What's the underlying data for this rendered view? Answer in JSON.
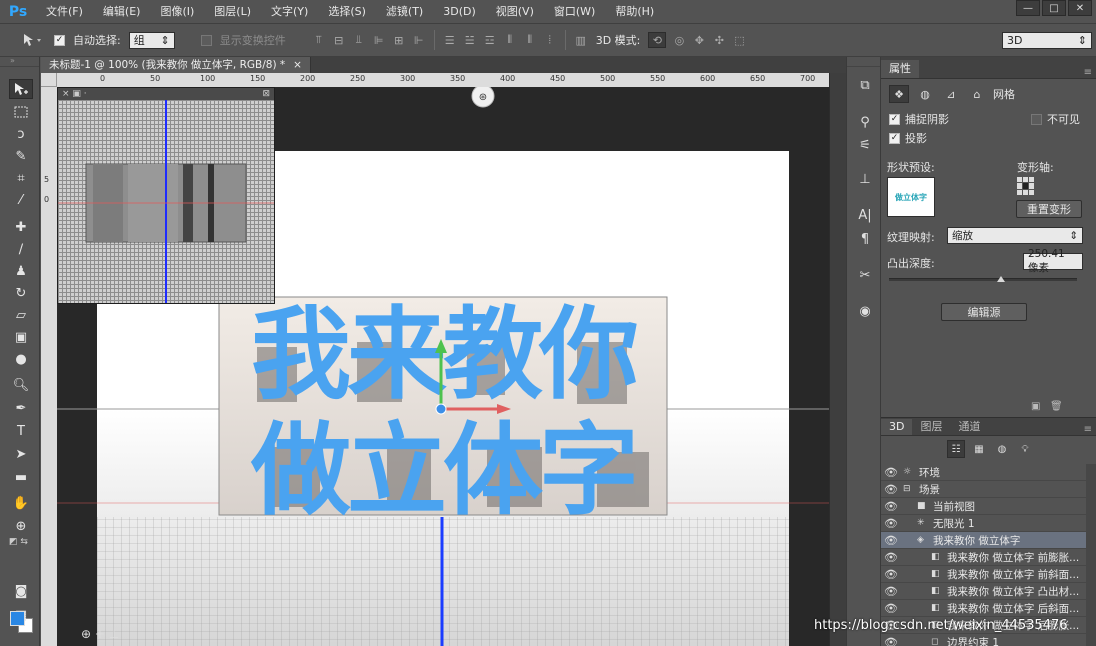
{
  "app": {
    "logo": "Ps"
  },
  "menu": [
    "文件(F)",
    "编辑(E)",
    "图像(I)",
    "图层(L)",
    "文字(Y)",
    "选择(S)",
    "滤镜(T)",
    "3D(D)",
    "视图(V)",
    "窗口(W)",
    "帮助(H)"
  ],
  "window_controls": {
    "minimize": "—",
    "maximize": "□",
    "close": "✕"
  },
  "options": {
    "auto_select_label": "自动选择:",
    "auto_select_checked": true,
    "auto_select_value": "组",
    "show_transform_label": "显示变换控件",
    "show_transform_checked": false,
    "mode_3d_label": "3D 模式:",
    "workspace_value": "3D"
  },
  "document": {
    "tab_title": "未标题-1 @ 100% (我来教你 做立体字, RGB/8) *",
    "tab_close": "×",
    "ruler_h_marks": [
      "0",
      "50",
      "100",
      "150",
      "200",
      "250",
      "300",
      "350",
      "400",
      "450",
      "500",
      "550",
      "600",
      "650",
      "700",
      "750"
    ],
    "text_line1": "我来教你",
    "text_line2": "做立体字"
  },
  "properties": {
    "tab": "属性",
    "subtab_mesh": "网格",
    "catch_shadows": "捕捉阴影",
    "catch_shadows_checked": true,
    "invisible": "不可见",
    "invisible_checked": false,
    "cast_shadows": "投影",
    "cast_shadows_checked": true,
    "shape_preset_label": "形状预设:",
    "shape_preset_thumb": "做立体字",
    "deform_axis_label": "变形轴:",
    "reset_deform_btn": "重置变形",
    "texture_map_label": "纹理映射:",
    "texture_map_value": "缩放",
    "extrusion_depth_label": "凸出深度:",
    "extrusion_depth_value": "250.41 像素",
    "edit_source_btn": "编辑源"
  },
  "panel3d": {
    "tabs": [
      "3D",
      "图层",
      "通道"
    ],
    "rows": [
      {
        "label": "环境",
        "indent": 0,
        "selected": false
      },
      {
        "label": "场景",
        "indent": 0,
        "selected": false
      },
      {
        "label": "当前视图",
        "indent": 1,
        "selected": false
      },
      {
        "label": "无限光 1",
        "indent": 1,
        "selected": false
      },
      {
        "label": "我来教你 做立体字",
        "indent": 1,
        "selected": true
      },
      {
        "label": "我来教你 做立体字 前膨胀...",
        "indent": 2,
        "selected": false
      },
      {
        "label": "我来教你 做立体字 前斜面...",
        "indent": 2,
        "selected": false
      },
      {
        "label": "我来教你 做立体字 凸出材...",
        "indent": 2,
        "selected": false
      },
      {
        "label": "我来教你 做立体字 后斜面...",
        "indent": 2,
        "selected": false
      },
      {
        "label": "我来教你 做立体字 后膨胀...",
        "indent": 2,
        "selected": false
      },
      {
        "label": "边界约束 1",
        "indent": 2,
        "selected": false
      }
    ]
  },
  "watermark": "https://blog.csdn.net/weixin_44535476",
  "colors": {
    "accent_blue": "#31a8ff",
    "text_fill": "#4aa3f0",
    "fg_swatch": "#2a87e4"
  }
}
